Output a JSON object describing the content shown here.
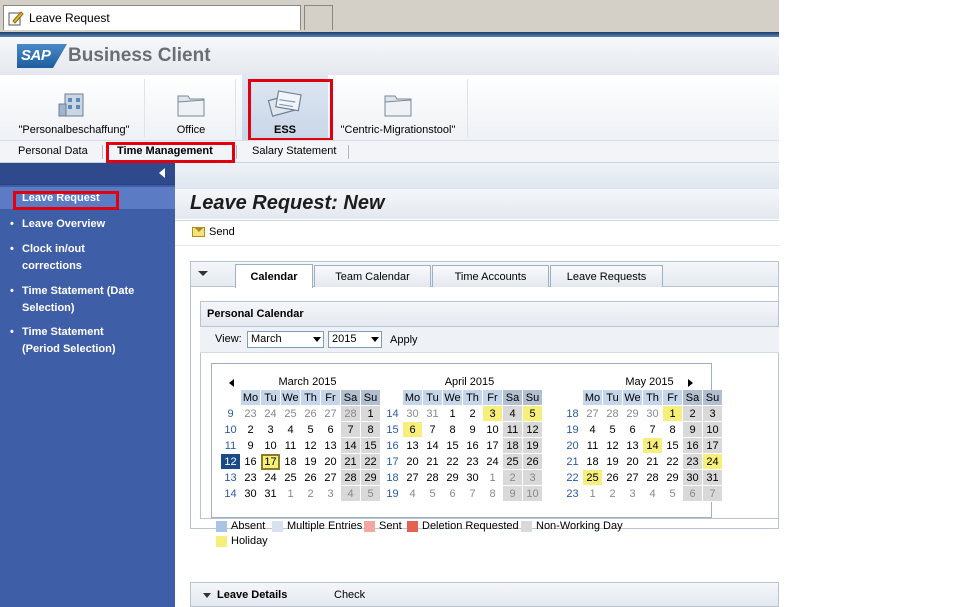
{
  "window": {
    "tab_title": "Leave Request",
    "tab_icon": "edit-document-icon"
  },
  "header": {
    "logo": "SAP",
    "app_title": "Business Client"
  },
  "launchpad": [
    {
      "label": "\"Personalbeschaffung\"",
      "icon": "building-icon"
    },
    {
      "label": "Office",
      "icon": "folder-icon"
    },
    {
      "label": "ESS",
      "icon": "documents-icon"
    },
    {
      "label": "\"Centric-Migrationstool\"",
      "icon": "folder-icon"
    }
  ],
  "subnav": [
    "Personal Data",
    "Time Management",
    "Salary Statement"
  ],
  "sidebar": {
    "items": [
      {
        "label": "Leave Request"
      },
      {
        "label": "Leave Overview"
      },
      {
        "label": "Clock in/out corrections",
        "lines": [
          "Clock in/out",
          "corrections"
        ]
      },
      {
        "label": "Time Statement (Date Selection)",
        "lines": [
          "Time Statement (Date",
          "Selection)"
        ]
      },
      {
        "label": "Time Statement (Period Selection)",
        "lines": [
          "Time Statement",
          "(Period Selection)"
        ]
      }
    ]
  },
  "page": {
    "title": "Leave Request: New",
    "send_label": "Send"
  },
  "tabs": [
    "Calendar",
    "Team Calendar",
    "Time Accounts",
    "Leave Requests"
  ],
  "personal_calendar": {
    "title": "Personal Calendar",
    "view_label": "View:",
    "month_value": "March",
    "year_value": "2015",
    "apply_label": "Apply",
    "weekday_headers": [
      "Mo",
      "Tu",
      "We",
      "Th",
      "Fr",
      "Sa",
      "Su"
    ],
    "months": [
      {
        "title": "March 2015",
        "weeks": [
          {
            "wk": "9",
            "days": [
              "23",
              "24",
              "25",
              "26",
              "27",
              "28",
              "1"
            ]
          },
          {
            "wk": "10",
            "days": [
              "2",
              "3",
              "4",
              "5",
              "6",
              "7",
              "8"
            ]
          },
          {
            "wk": "11",
            "days": [
              "9",
              "10",
              "11",
              "12",
              "13",
              "14",
              "15"
            ]
          },
          {
            "wk": "12",
            "days": [
              "16",
              "17",
              "18",
              "19",
              "20",
              "21",
              "22"
            ]
          },
          {
            "wk": "13",
            "days": [
              "23",
              "24",
              "25",
              "26",
              "27",
              "28",
              "29"
            ]
          },
          {
            "wk": "14",
            "days": [
              "30",
              "31",
              "1",
              "2",
              "3",
              "4",
              "5"
            ]
          }
        ]
      },
      {
        "title": "April 2015",
        "weeks": [
          {
            "wk": "14",
            "days": [
              "30",
              "31",
              "1",
              "2",
              "3",
              "4",
              "5"
            ]
          },
          {
            "wk": "15",
            "days": [
              "6",
              "7",
              "8",
              "9",
              "10",
              "11",
              "12"
            ]
          },
          {
            "wk": "16",
            "days": [
              "13",
              "14",
              "15",
              "16",
              "17",
              "18",
              "19"
            ]
          },
          {
            "wk": "17",
            "days": [
              "20",
              "21",
              "22",
              "23",
              "24",
              "25",
              "26"
            ]
          },
          {
            "wk": "18",
            "days": [
              "27",
              "28",
              "29",
              "30",
              "1",
              "2",
              "3"
            ]
          },
          {
            "wk": "19",
            "days": [
              "4",
              "5",
              "6",
              "7",
              "8",
              "9",
              "10"
            ]
          }
        ]
      },
      {
        "title": "May 2015",
        "weeks": [
          {
            "wk": "18",
            "days": [
              "27",
              "28",
              "29",
              "30",
              "1",
              "2",
              "3"
            ]
          },
          {
            "wk": "19",
            "days": [
              "4",
              "5",
              "6",
              "7",
              "8",
              "9",
              "10"
            ]
          },
          {
            "wk": "20",
            "days": [
              "11",
              "12",
              "13",
              "14",
              "15",
              "16",
              "17"
            ]
          },
          {
            "wk": "21",
            "days": [
              "18",
              "19",
              "20",
              "21",
              "22",
              "23",
              "24"
            ]
          },
          {
            "wk": "22",
            "days": [
              "25",
              "26",
              "27",
              "28",
              "29",
              "30",
              "31"
            ]
          },
          {
            "wk": "23",
            "days": [
              "1",
              "2",
              "3",
              "4",
              "5",
              "6",
              "7"
            ]
          }
        ]
      }
    ],
    "legend": [
      {
        "label": "Absent",
        "color": "#a9c4e4"
      },
      {
        "label": "Multiple Entries",
        "color": "#d7e2f0"
      },
      {
        "label": "Sent",
        "color": "#f2a7a0"
      },
      {
        "label": "Deletion Requested",
        "color": "#e2634f"
      },
      {
        "label": "Non-Working Day",
        "color": "#d9d9d9"
      },
      {
        "label": "Holiday",
        "color": "#f7ef7b"
      }
    ]
  },
  "leave_details": {
    "title": "Leave Details",
    "check_label": "Check"
  },
  "colors": {
    "sidebar": "#3f5ea8",
    "highlight_box": "#e00010",
    "selected_week": "#1a4b87"
  }
}
